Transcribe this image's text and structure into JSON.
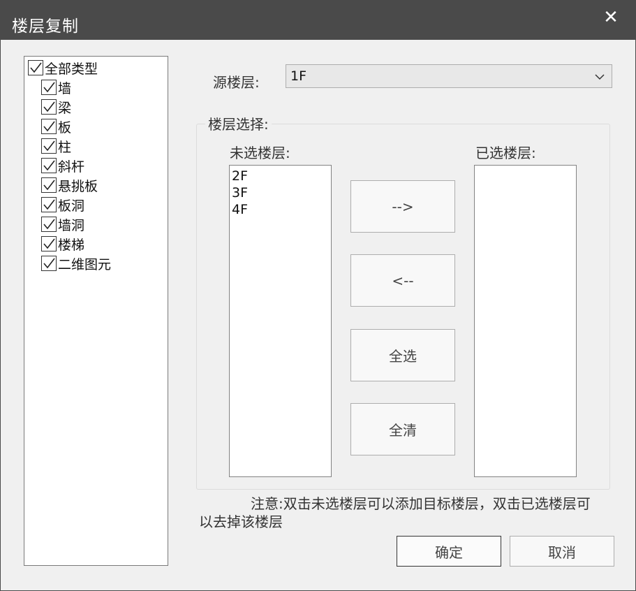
{
  "window": {
    "title": "楼层复制",
    "close_label": "✕"
  },
  "tree": {
    "items": [
      {
        "label": "全部类型",
        "checked": true
      },
      {
        "label": "墙",
        "checked": true
      },
      {
        "label": "梁",
        "checked": true
      },
      {
        "label": "板",
        "checked": true
      },
      {
        "label": "柱",
        "checked": true
      },
      {
        "label": "斜杆",
        "checked": true
      },
      {
        "label": "悬挑板",
        "checked": true
      },
      {
        "label": "板洞",
        "checked": true
      },
      {
        "label": "墙洞",
        "checked": true
      },
      {
        "label": "楼梯",
        "checked": true
      },
      {
        "label": "二维图元",
        "checked": true
      }
    ]
  },
  "source": {
    "label": "源楼层:",
    "value": "1F"
  },
  "floor_select": {
    "group_title": "楼层选择:",
    "unselected_label": "未选楼层:",
    "selected_label": "已选楼层:",
    "unselected": [
      "2F",
      "3F",
      "4F"
    ],
    "selected": []
  },
  "buttons": {
    "add": "-->",
    "remove": "<--",
    "select_all": "全选",
    "clear_all": "全清",
    "ok": "确定",
    "cancel": "取消"
  },
  "note": "注意:双击未选楼层可以添加目标楼层，双击已选楼层可以去掉该楼层"
}
